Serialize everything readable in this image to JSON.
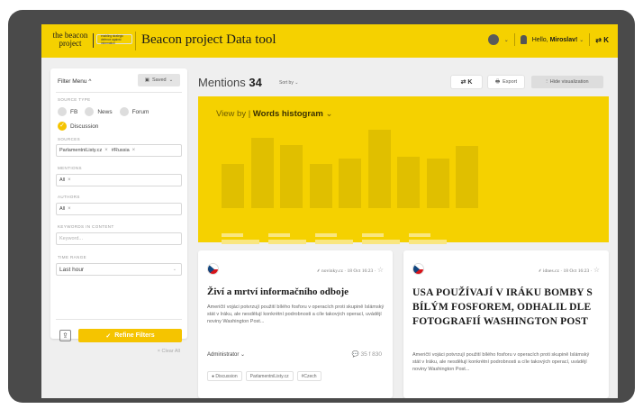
{
  "header": {
    "logo_line1": "the beacon",
    "logo_line2": "project",
    "logo_tagline": "enabling strategic defence against information",
    "app_title": "Beacon project Data tool",
    "user_greeting": "Hello,",
    "user_name": "Miroslav!",
    "flag_button": "⇄ K"
  },
  "filter": {
    "menu_label": "Filter Menu ^",
    "saved_label": "Saved",
    "source_type_label": "SOURCE TYPE",
    "source_types": [
      {
        "label": "FB",
        "selected": false
      },
      {
        "label": "News",
        "selected": false
      },
      {
        "label": "Forum",
        "selected": false
      },
      {
        "label": "Discussion",
        "selected": true
      }
    ],
    "sources_label": "SOURCES",
    "sources": [
      "ParlamentniListy.cz",
      "#Russia"
    ],
    "mentions_label": "MENTIONS",
    "mentions_value": "All",
    "authors_label": "AUTHORS",
    "authors_value": "All",
    "keywords_label": "KEYWORDS IN CONTENT",
    "keywords_placeholder": "Keyword...",
    "time_label": "TIME RANGE",
    "time_value": "Last hour",
    "refine_label": "Refine Filters",
    "clear_label": "× Clear All"
  },
  "mentions": {
    "title": "Mentions",
    "count": "34",
    "sort_label": "Sort by",
    "flag_button": "⇄ K",
    "export_label": "Export",
    "hide_label": "Hide visualization"
  },
  "visualization": {
    "view_label": "View by",
    "view_value": "Words histogram",
    "bar_levels": [
      0.49,
      0.78,
      0.7,
      0.49,
      0.55,
      0.87,
      0.57,
      0.55,
      0.69
    ]
  },
  "cards": [
    {
      "source": "novinky.cz",
      "date": "18 Oct 16:23",
      "title": "Živí a mrtví informačního odboje",
      "body": "Američtí vojáci potvrzují použití bílého fosforu v operacích proti skupině Islámský stát v Iráku, ale nesdělují konkrétní podrobnosti a cíle takových operací, uvádějí noviny Washington Post...",
      "author": "Administrator",
      "comments": "35",
      "shares": "830",
      "tags": [
        "Discussion",
        "ParlamentniListy.cz",
        "Czech"
      ]
    },
    {
      "source": "idnes.cz",
      "date": "18 Oct 16:23",
      "title": "USA POUŽÍVAJÍ V IRÁKU BOMBY S BÍLÝM FOSFOREM, ODHALIL DLE FOTOGRAFIÍ WASHINGTON POST",
      "body": "Američtí vojáci potvrzují použití bílého fosforu v operacích proti skupině Islámský stát v Iráku, ale nesdělují konkrétní podrobnosti a cíle takových operací, uvádějí noviny Washington Post..."
    }
  ]
}
